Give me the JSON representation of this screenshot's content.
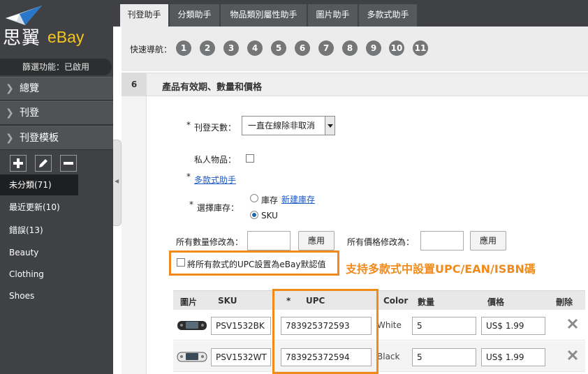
{
  "brand": {
    "name_cn": "思翼",
    "name_en": "eBay",
    "accent": "#f5c61b"
  },
  "sidebar": {
    "filter_status": "篩選功能：已啟用",
    "nav": [
      {
        "label": "總覽"
      },
      {
        "label": "刊登"
      },
      {
        "label": "刊登模板"
      }
    ],
    "categories": [
      {
        "label": "未分類(71)",
        "active": true
      },
      {
        "label": "最近更新(10)"
      },
      {
        "label": "錯誤(13)"
      },
      {
        "label": "Beauty"
      },
      {
        "label": "Clothing"
      },
      {
        "label": "Shoes"
      }
    ]
  },
  "tabs": [
    {
      "label": "刊登助手",
      "active": true
    },
    {
      "label": "分類助手"
    },
    {
      "label": "物品類別屬性助手"
    },
    {
      "label": "圖片助手"
    },
    {
      "label": "多款式助手"
    }
  ],
  "quicknav": {
    "label": "快速導航：",
    "steps": [
      "1",
      "2",
      "3",
      "4",
      "5",
      "6",
      "7",
      "8",
      "9",
      "10",
      "11"
    ]
  },
  "section": {
    "number": "6",
    "title": "產品有效期、數量和價格"
  },
  "form": {
    "duration_label": "刊登天數：",
    "duration_value": "一直在線除非取消",
    "private_label": "私人物品：",
    "variation_link": "多款式助手",
    "inventory_label": "選擇庫存：",
    "inventory_option_stock": "庫存",
    "inventory_new_link": "新建庫存",
    "inventory_option_sku": "SKU",
    "bulk_qty_label": "所有數量修改為：",
    "bulk_qty_value": "",
    "bulk_qty_apply": "應用",
    "bulk_price_label": "所有價格修改為：",
    "bulk_price_value": "",
    "bulk_price_apply": "應用",
    "upc_default_checkbox": "將所有款式的UPC設置為eBay默認值"
  },
  "callout": "支持多款式中設置UPC/EAN/ISBN碼",
  "table": {
    "headers": {
      "image": "圖片",
      "sku": "SKU",
      "upc_required": "*",
      "upc": "UPC",
      "color": "Color",
      "qty": "數量",
      "price": "價格",
      "delete": "刪除"
    },
    "rows": [
      {
        "sku": "PSV1532BK",
        "upc": "783925372593",
        "color": "White",
        "qty": "5",
        "price": "US$ 1.99"
      },
      {
        "sku": "PSV1532WT",
        "upc": "783925372594",
        "color": "Black",
        "qty": "5",
        "price": "US$ 1.99"
      }
    ]
  },
  "colors": {
    "highlight": "#f08a1a",
    "link": "#1a58c7",
    "required": "#d40000"
  }
}
